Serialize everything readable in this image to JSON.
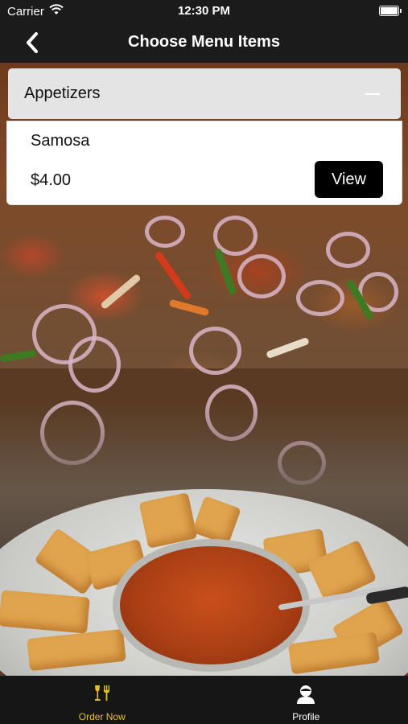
{
  "status_bar": {
    "carrier": "Carrier",
    "time": "12:30 PM",
    "icons": [
      "wifi-icon",
      "battery-icon"
    ]
  },
  "nav": {
    "title": "Choose Menu Items",
    "back_icon": "chevron-left-icon"
  },
  "accordion": {
    "title": "Appetizers",
    "toggle_icon": "minus-icon",
    "items": [
      {
        "name": "Samosa",
        "price": "$4.00",
        "button_label": "View"
      }
    ]
  },
  "tab_bar": {
    "tabs": [
      {
        "label": "Order Now",
        "icon": "fork-glass-icon",
        "color": "#e6c12a",
        "active": true
      },
      {
        "label": "Profile",
        "icon": "user-icon",
        "color": "#ffffff",
        "active": false
      }
    ]
  },
  "colors": {
    "bar_background": "#1b1b1b",
    "accent": "#e6c12a",
    "button": "#000000",
    "accordion_header": "#e4e4e4"
  }
}
